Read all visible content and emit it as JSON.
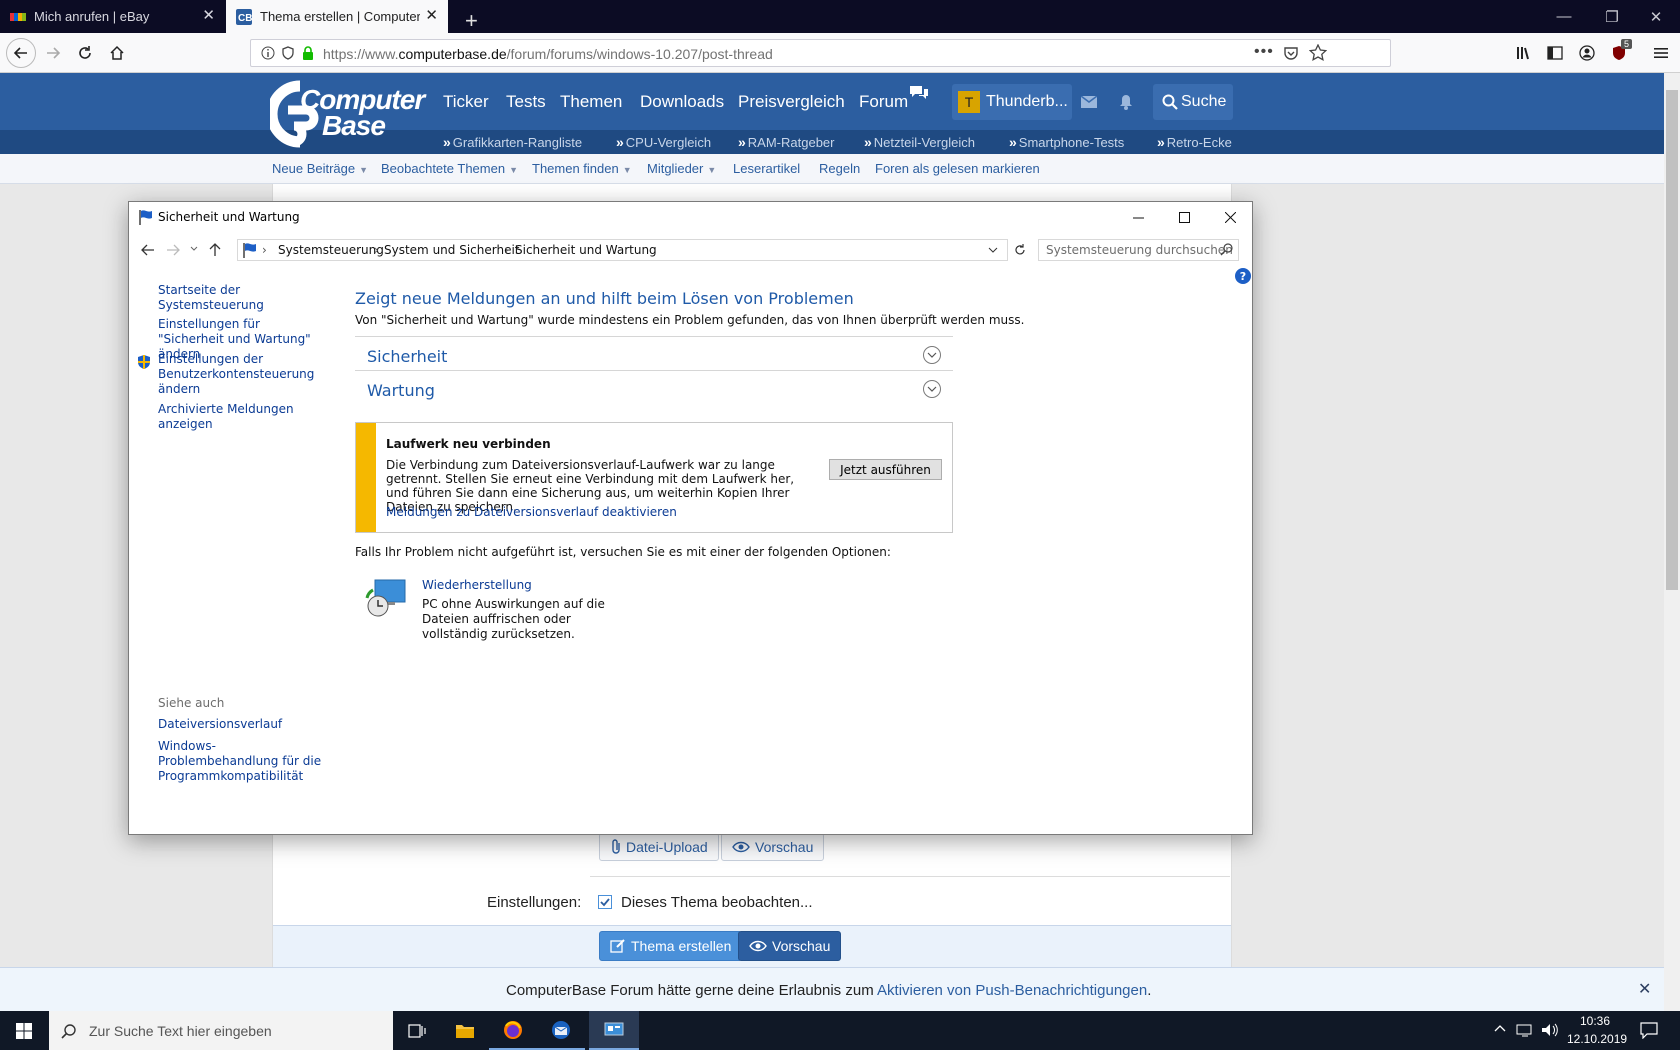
{
  "browser": {
    "tabs": [
      {
        "title": "Mich anrufen | eBay",
        "active": false
      },
      {
        "title": "Thema erstellen | ComputerBa",
        "active": true
      }
    ],
    "url_prefix": "https://www.",
    "url_domain": "computerbase.de",
    "url_path": "/forum/forums/windows-10.207/post-thread",
    "badge_count": "5"
  },
  "site": {
    "logo_line1": "Computer",
    "logo_line2": "Base",
    "main_nav": [
      "Ticker",
      "Tests",
      "Themen",
      "Downloads",
      "Preisvergleich",
      "Forum"
    ],
    "user_name": "Thunderb...",
    "user_initial": "T",
    "search_label": "Suche",
    "sub_nav": [
      "Grafikkarten-Rangliste",
      "CPU-Vergleich",
      "RAM-Ratgeber",
      "Netzteil-Vergleich",
      "Smartphone-Tests",
      "Retro-Ecke"
    ],
    "forum_bar": [
      "Neue Beiträge",
      "Beobachtete Themen",
      "Themen finden",
      "Mitglieder",
      "Leserartikel",
      "Regeln",
      "Foren als gelesen markieren"
    ]
  },
  "form": {
    "upload_label": "Datei-Upload",
    "preview_label": "Vorschau",
    "settings_label": "Einstellungen:",
    "watch_label": "Dieses Thema beobachten...",
    "watch_checked": true,
    "create_label": "Thema erstellen",
    "preview2_label": "Vorschau"
  },
  "notification": {
    "text": "ComputerBase Forum hätte gerne deine Erlaubnis zum ",
    "link": "Aktivieren von Push-Benachrichtigungen",
    "end": "."
  },
  "dialog": {
    "title": "Sicherheit und Wartung",
    "breadcrumb": [
      "Systemsteuerung",
      "System und Sicherheit",
      "Sicherheit und Wartung"
    ],
    "search_placeholder": "Systemsteuerung durchsuchen",
    "left_links": {
      "home": "Startseite der Systemsteuerung",
      "settings": "Einstellungen für \"Sicherheit und Wartung\" ändern",
      "uac": "Einstellungen der Benutzerkontensteuerung ändern",
      "archive": "Archivierte Meldungen anzeigen"
    },
    "see_also": "Siehe auch",
    "see_also_links": [
      "Dateiversionsverlauf",
      "Windows-Problembehandlung für die Programmkompatibilität"
    ],
    "heading": "Zeigt neue Meldungen an und hilft beim Lösen von Problemen",
    "subtitle": "Von \"Sicherheit und Wartung\" wurde mindestens ein Problem gefunden, das von Ihnen überprüft werden muss.",
    "sections": [
      "Sicherheit",
      "Wartung"
    ],
    "alert": {
      "title": "Laufwerk neu verbinden",
      "body": "Die Verbindung zum Dateiversionsverlauf-Laufwerk war zu lange getrennt. Stellen Sie erneut eine Verbindung mit dem Laufwerk her, und führen Sie dann eine Sicherung aus, um weiterhin Kopien Ihrer Dateien zu speichern.",
      "link": "Meldungen zu Dateiversionsverlauf deaktivieren",
      "button": "Jetzt ausführen"
    },
    "fallback_text": "Falls Ihr Problem nicht aufgeführt ist, versuchen Sie es mit einer der folgenden Optionen:",
    "recovery_title": "Wiederherstellung",
    "recovery_desc": "PC ohne Auswirkungen auf die Dateien auffrischen oder vollständig zurücksetzen."
  },
  "taskbar": {
    "search_placeholder": "Zur Suche Text hier eingeben",
    "time": "10:36",
    "date": "12.10.2019"
  },
  "colors": {
    "cb_blue": "#2c5ea0",
    "alert_yellow": "#f5b800",
    "win_link": "#0b3b94"
  }
}
